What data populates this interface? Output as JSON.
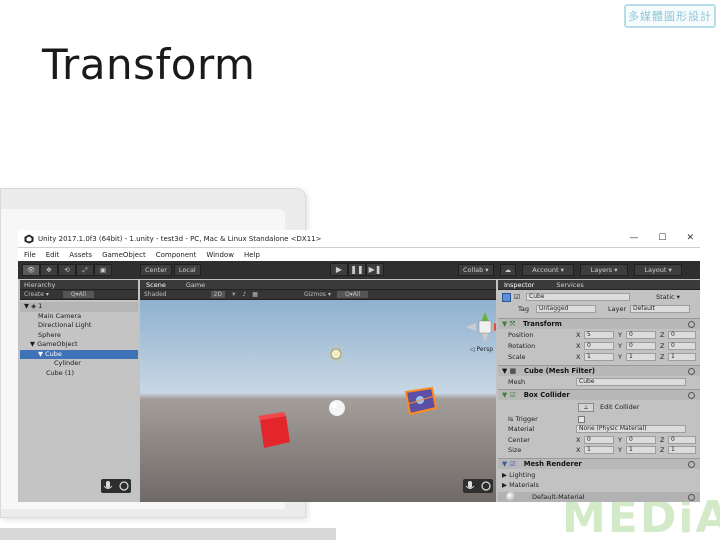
{
  "slide": {
    "title": "Transform",
    "logo_text": "多媒體圖形設計",
    "watermark": "MEDiA"
  },
  "unity": {
    "window_title": "Unity 2017.1.0f3 (64bit) - 1.unity - test3d - PC, Mac & Linux Standalone <DX11>",
    "window_buttons": [
      "—",
      "☐",
      "✕"
    ],
    "menu": [
      "File",
      "Edit",
      "Assets",
      "GameObject",
      "Component",
      "Window",
      "Help"
    ],
    "toolbar": {
      "tools": [
        "👁",
        "✥",
        "⟲",
        "⤢",
        "▣"
      ],
      "pivot": "Center",
      "space": "Local",
      "play": "▶",
      "pause": "❚❚",
      "step": "▶❚",
      "collab": "Collab ▾",
      "cloud": "☁",
      "account": "Account ▾",
      "layers": "Layers ▾",
      "layout": "Layout ▾"
    },
    "hierarchy": {
      "tab": "Hierarchy",
      "create": "Create ▾",
      "search": "Q▾All",
      "scene_name": "1",
      "items": [
        {
          "label": "Main Camera",
          "indent": 1,
          "selected": false
        },
        {
          "label": "Directional Light",
          "indent": 1,
          "selected": false
        },
        {
          "label": "Sphere",
          "indent": 1,
          "selected": false
        },
        {
          "label": "▼ GameObject",
          "indent": 0,
          "selected": false
        },
        {
          "label": "▼ Cube",
          "indent": 1,
          "selected": true
        },
        {
          "label": "Cylinder",
          "indent": 2,
          "selected": false
        },
        {
          "label": "Cube (1)",
          "indent": 1,
          "selected": false
        }
      ]
    },
    "scene": {
      "tab_scene": "Scene",
      "tab_game": "Game",
      "shaded": "Shaded",
      "mode_2d": "2D",
      "gizmos": "Gizmos ▾",
      "search": "Q▾All",
      "persp": "◁ Persp"
    },
    "inspector": {
      "tab": "Inspector",
      "tab_services": "Services",
      "object_name": "Cube",
      "static": "Static ▾",
      "tag_label": "Tag",
      "tag_value": "Untagged",
      "layer_label": "Layer",
      "layer_value": "Default",
      "transform": {
        "title": "Transform",
        "rows": [
          {
            "label": "Position",
            "x": "5",
            "y": "0",
            "z": "0"
          },
          {
            "label": "Rotation",
            "x": "0",
            "y": "0",
            "z": "0"
          },
          {
            "label": "Scale",
            "x": "1",
            "y": "1",
            "z": "1"
          }
        ]
      },
      "mesh_filter": {
        "title": "Cube (Mesh Filter)",
        "mesh_label": "Mesh",
        "mesh_value": "Cube"
      },
      "box_collider": {
        "title": "Box Collider",
        "edit_label": "Edit Collider",
        "is_trigger": "Is Trigger",
        "material_label": "Material",
        "material_value": "None (Physic Material)",
        "center_label": "Center",
        "center": {
          "x": "0",
          "y": "0",
          "z": "0"
        },
        "size_label": "Size",
        "size": {
          "x": "1",
          "y": "1",
          "z": "1"
        }
      },
      "mesh_renderer": {
        "title": "Mesh Renderer",
        "lighting": "Lighting",
        "materials": "Materials"
      },
      "default_material": "Default-Material"
    }
  }
}
